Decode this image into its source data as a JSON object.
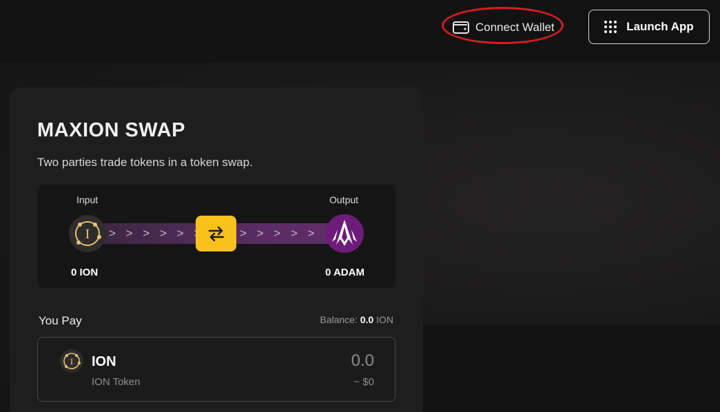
{
  "header": {
    "connect_wallet_label": "Connect Wallet",
    "launch_app_label": "Launch App"
  },
  "swap": {
    "title": "MAXION SWAP",
    "subtitle": "Two parties trade tokens in a token swap.",
    "input_label": "Input",
    "output_label": "Output",
    "input_amount": "0 ION",
    "output_amount": "0 ADAM",
    "chevrons_left": "> > > > > > >",
    "chevrons_right": "> > > > > > >",
    "input_token_icon": "ion-logo-icon",
    "output_token_icon": "adam-logo-icon",
    "swap_icon": "swap-arrows-icon"
  },
  "pay": {
    "label": "You Pay",
    "balance_prefix": "Balance:",
    "balance_value": "0.0",
    "balance_unit": "ION",
    "token_symbol": "ION",
    "token_name": "ION Token",
    "amount": "0.0",
    "usd_value": "~ $0"
  },
  "colors": {
    "accent_yellow": "#f7c21a",
    "adam_purple": "#6d1c7a",
    "annotation_red": "#d81b22",
    "ion_gold": "#e8c27a"
  }
}
